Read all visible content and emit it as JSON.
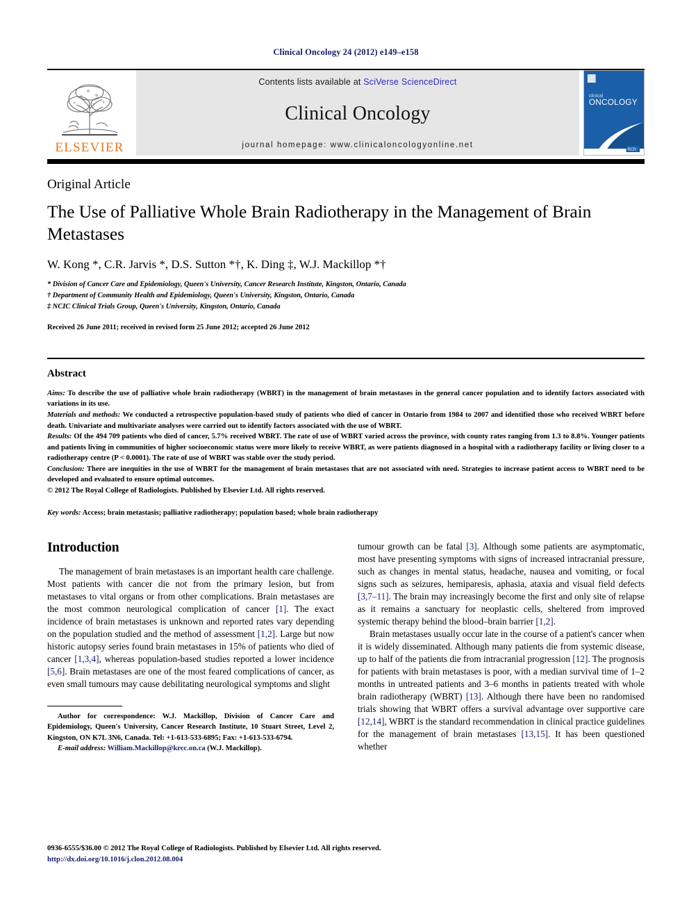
{
  "running_head": "Clinical Oncology 24 (2012) e149–e158",
  "masthead": {
    "publisher_logo_text": "ELSEVIER",
    "contents_prefix": "Contents lists available at ",
    "contents_link": "SciVerse ScienceDirect",
    "journal_name": "Clinical Oncology",
    "homepage_label": "journal homepage: www.clinicaloncologyonline.net",
    "cover": {
      "line1": "clinical",
      "line2": "ONCOLOGY",
      "badge": "RCR"
    }
  },
  "article": {
    "type": "Original Article",
    "title": "The Use of Palliative Whole Brain Radiotherapy in the Management of Brain Metastases",
    "authors": "W. Kong *, C.R. Jarvis *, D.S. Sutton *†, K. Ding ‡, W.J. Mackillop *†",
    "affiliations": [
      "* Division of Cancer Care and Epidemiology, Queen's University, Cancer Research Institute, Kingston, Ontario, Canada",
      "† Department of Community Health and Epidemiology, Queen's University, Kingston, Ontario, Canada",
      "‡ NCIC Clinical Trials Group, Queen's University, Kingston, Ontario, Canada"
    ],
    "history": "Received 26 June 2011; received in revised form 25 June 2012; accepted 26 June 2012"
  },
  "abstract": {
    "heading": "Abstract",
    "aims_label": "Aims:",
    "aims_text": " To describe the use of palliative whole brain radiotherapy (WBRT) in the management of brain metastases in the general cancer population and to identify factors associated with variations in its use.",
    "methods_label": "Materials and methods:",
    "methods_text": " We conducted a retrospective population-based study of patients who died of cancer in Ontario from 1984 to 2007 and identified those who received WBRT before death. Univariate and multivariate analyses were carried out to identify factors associated with the use of WBRT.",
    "results_label": "Results:",
    "results_text": " Of the 494 709 patients who died of cancer, 5.7% received WBRT. The rate of use of WBRT varied across the province, with county rates ranging from 1.3 to 8.8%. Younger patients and patients living in communities of higher socioeconomic status were more likely to receive WBRT, as were patients diagnosed in a hospital with a radiotherapy facility or living closer to a radiotherapy centre (P < 0.0001). The rate of use of WBRT was stable over the study period.",
    "conclusion_label": "Conclusion:",
    "conclusion_text": " There are inequities in the use of WBRT for the management of brain metastases that are not associated with need. Strategies to increase patient access to WBRT need to be developed and evaluated to ensure optimal outcomes.",
    "copyright": "© 2012 The Royal College of Radiologists. Published by Elsevier Ltd. All rights reserved.",
    "keywords_label": "Key words:",
    "keywords_text": " Access; brain metastasis; palliative radiotherapy; population based; whole brain radiotherapy"
  },
  "introduction": {
    "heading": "Introduction",
    "left_para_1_a": "The management of brain metastases is an important health care challenge. Most patients with cancer die not from the primary lesion, but from metastases to vital organs or from other complications. Brain metastases are the most common neurological complication of cancer ",
    "left_ref_1": "[1]",
    "left_para_1_b": ". The exact incidence of brain metastases is unknown and reported rates vary depending on the population studied and the method of assessment ",
    "left_ref_2": "[1,2]",
    "left_para_1_c": ". Large but now historic autopsy series found brain metastases in 15% of patients who died of cancer ",
    "left_ref_3": "[1,3,4]",
    "left_para_1_d": ", whereas population-based studies reported a lower incidence ",
    "left_ref_4": "[5,6]",
    "left_para_1_e": ". Brain metastases are one of the most feared complications of cancer, as even small tumours may cause debilitating neurological symptoms and slight",
    "right_para_1_a": "tumour growth can be fatal ",
    "right_ref_1": "[3]",
    "right_para_1_b": ". Although some patients are asymptomatic, most have presenting symptoms with signs of increased intracranial pressure, such as changes in mental status, headache, nausea and vomiting, or focal signs such as seizures, hemiparesis, aphasia, ataxia and visual field defects ",
    "right_ref_2": "[3,7–11]",
    "right_para_1_c": ". The brain may increasingly become the first and only site of relapse as it remains a sanctuary for neoplastic cells, sheltered from improved systemic therapy behind the blood–brain barrier ",
    "right_ref_3": "[1,2]",
    "right_para_1_d": ".",
    "right_para_2_a": "Brain metastases usually occur late in the course of a patient's cancer when it is widely disseminated. Although many patients die from systemic disease, up to half of the patients die from intracranial progression ",
    "right_ref_4": "[12]",
    "right_para_2_b": ". The prognosis for patients with brain metastases is poor, with a median survival time of 1–2 months in untreated patients and 3–6 months in patients treated with whole brain radiotherapy (WBRT) ",
    "right_ref_5": "[13]",
    "right_para_2_c": ". Although there have been no randomised trials showing that WBRT offers a survival advantage over supportive care ",
    "right_ref_6": "[12,14]",
    "right_para_2_d": ", WBRT is the standard recommendation in clinical practice guidelines for the management of brain metastases ",
    "right_ref_7": "[13,15]",
    "right_para_2_e": ". It has been questioned whether"
  },
  "footnote": {
    "correspondence": "Author for correspondence: W.J. Mackillop, Division of Cancer Care and Epidemiology, Queen's University, Cancer Research Institute, 10 Stuart Street, Level 2, Kingston, ON K7L 3N6, Canada. Tel: +1-613-533-6895; Fax: +1-613-533-6794.",
    "email_label": "E-mail address:",
    "email": "William.Mackillop@krcc.on.ca",
    "email_suffix": " (W.J. Mackillop)."
  },
  "page_footer": {
    "issn_line": "0936-6555/$36.00 © 2012 The Royal College of Radiologists. Published by Elsevier Ltd. All rights reserved.",
    "doi": "http://dx.doi.org/10.1016/j.clon.2012.08.004"
  },
  "colors": {
    "link_blue": "#151c6b",
    "sciencedirect_blue": "#2b2bbd",
    "elsevier_orange": "#e87722",
    "cover_blue": "#1b5fa8",
    "masthead_grey": "#e6e6e6"
  }
}
